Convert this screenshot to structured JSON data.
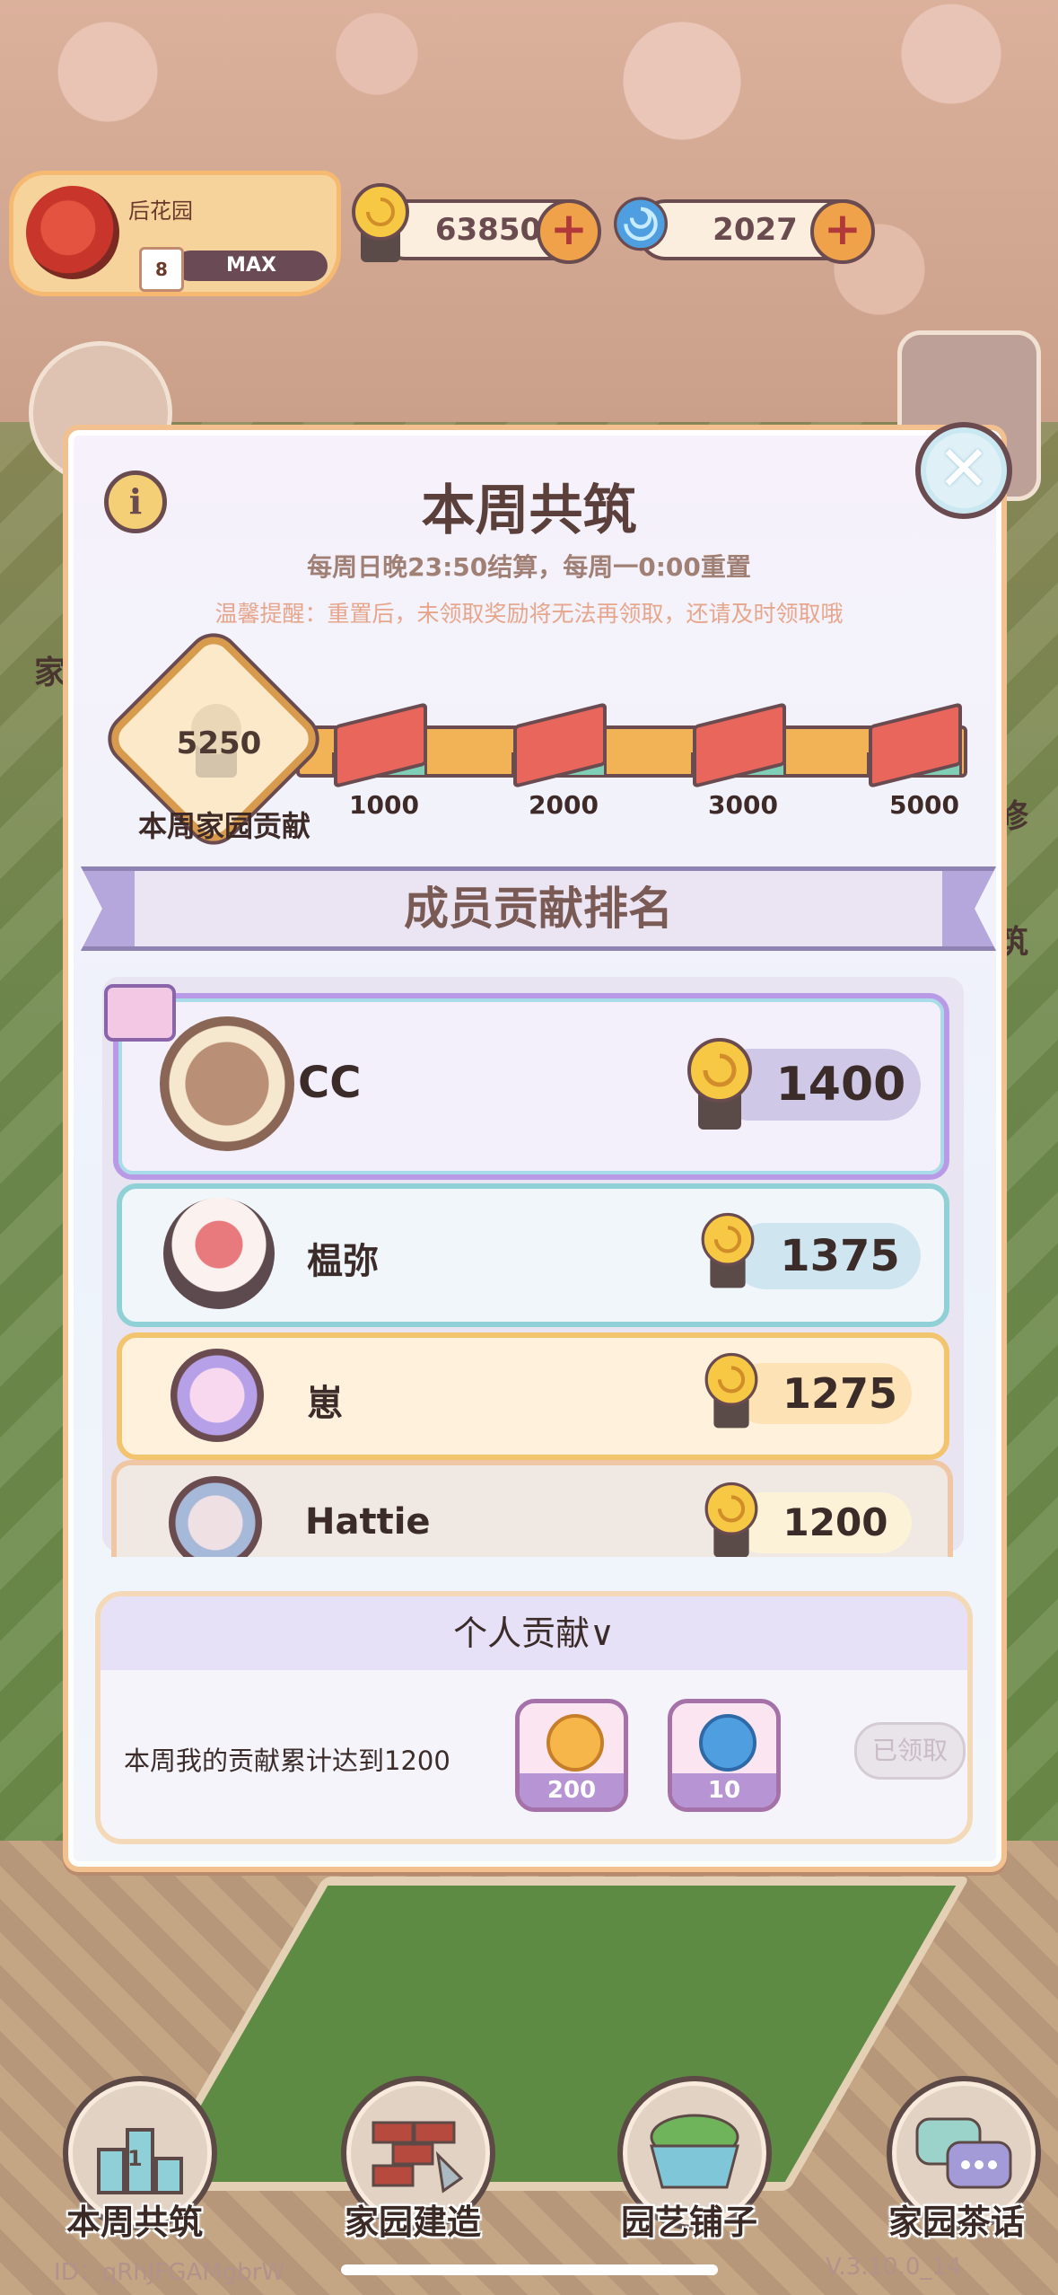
{
  "profile": {
    "garden_name": "后花园",
    "level": "8",
    "level_status": "MAX"
  },
  "currencies": {
    "gold": {
      "value": "63850",
      "plus": "+"
    },
    "gem": {
      "value": "2027",
      "plus": "+"
    }
  },
  "side": {
    "left_label": "家",
    "right_label_1": "修",
    "right_label_2": "筑"
  },
  "modal": {
    "title": "本周共筑",
    "subtitle": "每周日晚23:50结算，每周一0:00重置",
    "warning": "温馨提醒：重置后，未领取奖励将无法再领取，还请及时领取哦",
    "info_label": "i",
    "close_label": "✕"
  },
  "progress": {
    "current": "5250",
    "current_label": "本周家园贡献",
    "milestones": [
      "1000",
      "2000",
      "3000",
      "5000"
    ]
  },
  "ranking": {
    "title": "成员贡献排名",
    "members": [
      {
        "name": "CC",
        "score": "1400"
      },
      {
        "name": "榅弥",
        "score": "1375"
      },
      {
        "name": "崽",
        "score": "1275"
      },
      {
        "name": "Hattie",
        "score": "1200"
      }
    ]
  },
  "personal": {
    "title": "个人贡献∨",
    "description": "本周我的贡献累计达到1200",
    "rewards": [
      {
        "amount": "200"
      },
      {
        "amount": "10"
      }
    ],
    "claimed_label": "已领取"
  },
  "nav": {
    "items": [
      {
        "label": "本周共筑",
        "badge": "1"
      },
      {
        "label": "家园建造"
      },
      {
        "label": "园艺铺子"
      },
      {
        "label": "家园茶话"
      }
    ]
  },
  "footer": {
    "id": "ID：qRhJFGAMgbrW",
    "version": "V.3.10.0_14"
  },
  "colors": {
    "accent_gold": "#f1b355",
    "frame_orange": "#f2c18f",
    "text_brown": "#5b3f3b",
    "banner_purple": "#8f83b4"
  }
}
